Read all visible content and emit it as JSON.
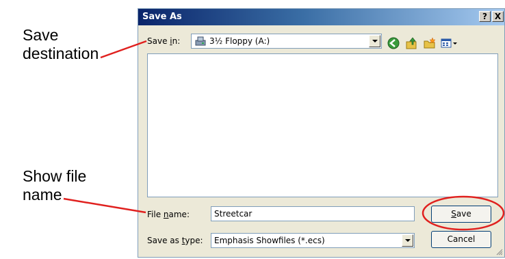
{
  "callouts": {
    "destination": [
      "Save",
      "destination"
    ],
    "filename": [
      "Show file",
      "name"
    ],
    "color": "#e0201e"
  },
  "dialog": {
    "title": "Save As",
    "help_label": "?",
    "close_label": "X",
    "save_in_label_pre": "Save ",
    "save_in_label_ul": "i",
    "save_in_label_post": "n:",
    "save_in_value": "3½ Floppy (A:)",
    "toolbar_icons": [
      "back-icon",
      "up-folder-icon",
      "new-folder-icon",
      "view-menu-icon"
    ],
    "file_name_label_pre": "File ",
    "file_name_label_ul": "n",
    "file_name_label_post": "ame:",
    "file_name_value": "Streetcar",
    "save_type_label_pre": "Save as ",
    "save_type_label_ul": "t",
    "save_type_label_post": "ype:",
    "save_type_value": "Emphasis Showfiles (*.ecs)",
    "save_button": "Save",
    "save_button_ul": "S",
    "save_button_rest": "ave",
    "cancel_button": "Cancel"
  }
}
